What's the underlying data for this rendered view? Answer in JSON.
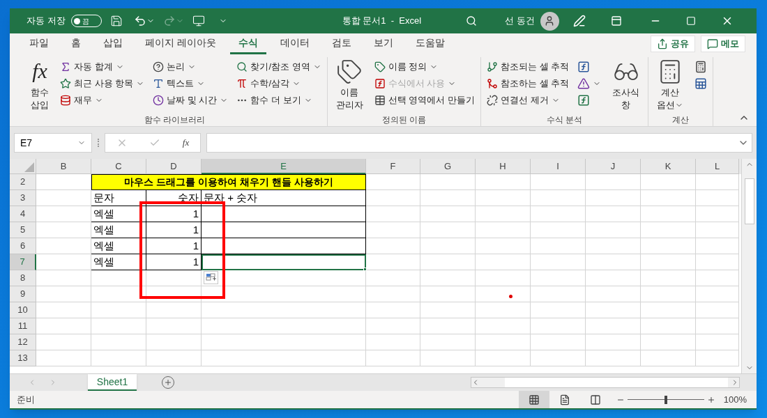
{
  "title_bar": {
    "autosave_label": "자동 저장",
    "autosave_toggle": {
      "label": "끔",
      "on": false
    },
    "title": "통합 문서1  -  Excel",
    "user": "선 동건"
  },
  "tabs": [
    {
      "label": "파일",
      "selected": false
    },
    {
      "label": "홈",
      "selected": false
    },
    {
      "label": "삽입",
      "selected": false
    },
    {
      "label": "페이지 레이아웃",
      "selected": false
    },
    {
      "label": "수식",
      "selected": true
    },
    {
      "label": "데이터",
      "selected": false
    },
    {
      "label": "검토",
      "selected": false
    },
    {
      "label": "보기",
      "selected": false
    },
    {
      "label": "도움말",
      "selected": false
    }
  ],
  "share_button": "공유",
  "memo_button": "메모",
  "ribbon": {
    "groups": [
      {
        "label": "함수 라이브러리",
        "items": [
          {
            "kind": "large",
            "icon_text": "fx",
            "lines": [
              "함수",
              "삽입"
            ],
            "dropdown": false,
            "disabled": false
          },
          {
            "kind": "small",
            "label": "자동 합계",
            "dropdown": true,
            "disabled": false
          },
          {
            "kind": "small",
            "label": "최근 사용 항목",
            "dropdown": true,
            "disabled": false
          },
          {
            "kind": "small",
            "label": "재무",
            "dropdown": true,
            "disabled": false
          },
          {
            "kind": "small",
            "label": "논리",
            "dropdown": true,
            "disabled": false
          },
          {
            "kind": "small",
            "label": "텍스트",
            "dropdown": true,
            "disabled": false
          },
          {
            "kind": "small",
            "label": "날짜 및 시간",
            "dropdown": true,
            "disabled": false
          },
          {
            "kind": "small",
            "label": "찾기/참조 영역",
            "dropdown": true,
            "disabled": false
          },
          {
            "kind": "small",
            "label": "수학/삼각",
            "dropdown": true,
            "disabled": false
          },
          {
            "kind": "small",
            "label": "함수 더 보기",
            "dropdown": true,
            "disabled": false
          }
        ]
      },
      {
        "label": "정의된 이름",
        "items": [
          {
            "kind": "large",
            "lines": [
              "이름",
              "관리자"
            ],
            "dropdown": false,
            "disabled": false
          },
          {
            "kind": "small",
            "label": "이름 정의",
            "dropdown": true,
            "disabled": false
          },
          {
            "kind": "small",
            "label": "수식에서 사용",
            "dropdown": true,
            "disabled": true
          },
          {
            "kind": "small",
            "label": "선택 영역에서 만들기",
            "dropdown": false,
            "disabled": false
          }
        ]
      },
      {
        "label": "수식 분석",
        "items": [
          {
            "kind": "small",
            "label": "참조되는 셀 추적",
            "dropdown": false,
            "disabled": false
          },
          {
            "kind": "small",
            "label": "참조하는 셀 추적",
            "dropdown": false,
            "disabled": false
          },
          {
            "kind": "small",
            "label": "연결선 제거",
            "dropdown": true,
            "disabled": false
          },
          {
            "kind": "icon",
            "dropdown": false,
            "disabled": false
          },
          {
            "kind": "icon",
            "dropdown": true,
            "disabled": false
          },
          {
            "kind": "icon",
            "dropdown": false,
            "disabled": false
          },
          {
            "kind": "large",
            "lines": [
              "조사식",
              "창"
            ],
            "dropdown": false,
            "disabled": false
          }
        ]
      },
      {
        "label": "계산",
        "items": [
          {
            "kind": "large",
            "lines": [
              "계산",
              "옵션"
            ],
            "dropdown": true,
            "disabled": false
          },
          {
            "kind": "icon",
            "dropdown": false,
            "disabled": false
          },
          {
            "kind": "icon",
            "dropdown": false,
            "disabled": false
          }
        ]
      }
    ]
  },
  "formula_bar": {
    "name_box": "E7",
    "fx": "fx"
  },
  "columns": [
    {
      "label": "B",
      "selected": false
    },
    {
      "label": "C",
      "selected": false
    },
    {
      "label": "D",
      "selected": false
    },
    {
      "label": "E",
      "selected": true
    },
    {
      "label": "F",
      "selected": false
    },
    {
      "label": "G",
      "selected": false
    },
    {
      "label": "H",
      "selected": false
    },
    {
      "label": "I",
      "selected": false
    },
    {
      "label": "J",
      "selected": false
    },
    {
      "label": "K",
      "selected": false
    },
    {
      "label": "L",
      "selected": false
    }
  ],
  "row_headers": [
    {
      "label": "2",
      "selected": false
    },
    {
      "label": "3",
      "selected": false
    },
    {
      "label": "4",
      "selected": false
    },
    {
      "label": "5",
      "selected": false
    },
    {
      "label": "6",
      "selected": false
    },
    {
      "label": "7",
      "selected": true
    },
    {
      "label": "8",
      "selected": false
    },
    {
      "label": "9",
      "selected": false
    },
    {
      "label": "10",
      "selected": false
    },
    {
      "label": "11",
      "selected": false
    },
    {
      "label": "12",
      "selected": false
    },
    {
      "label": "13",
      "selected": false
    }
  ],
  "table": {
    "title": "마우스 드래그를 이용하여 채우기 핸들 사용하기",
    "header": [
      "문자",
      "숫자",
      "문자 + 숫자"
    ],
    "rows": [
      {
        "cells": [
          "엑셀",
          "1"
        ],
        "selected": false
      },
      {
        "cells": [
          "엑셀",
          "1"
        ],
        "selected": false
      },
      {
        "cells": [
          "엑셀",
          "1"
        ],
        "selected": false
      },
      {
        "cells": [
          "엑셀",
          "1"
        ],
        "selected": true
      }
    ]
  },
  "sheet_tabs": [
    {
      "label": "Sheet1",
      "selected": true
    }
  ],
  "status_bar": {
    "status": "준비",
    "views": [
      {
        "kind": "normal",
        "selected": true
      },
      {
        "kind": "page_layout",
        "selected": false
      },
      {
        "kind": "page_break",
        "selected": false
      }
    ],
    "zoom": {
      "level": 0.5,
      "reading": "100%"
    }
  }
}
